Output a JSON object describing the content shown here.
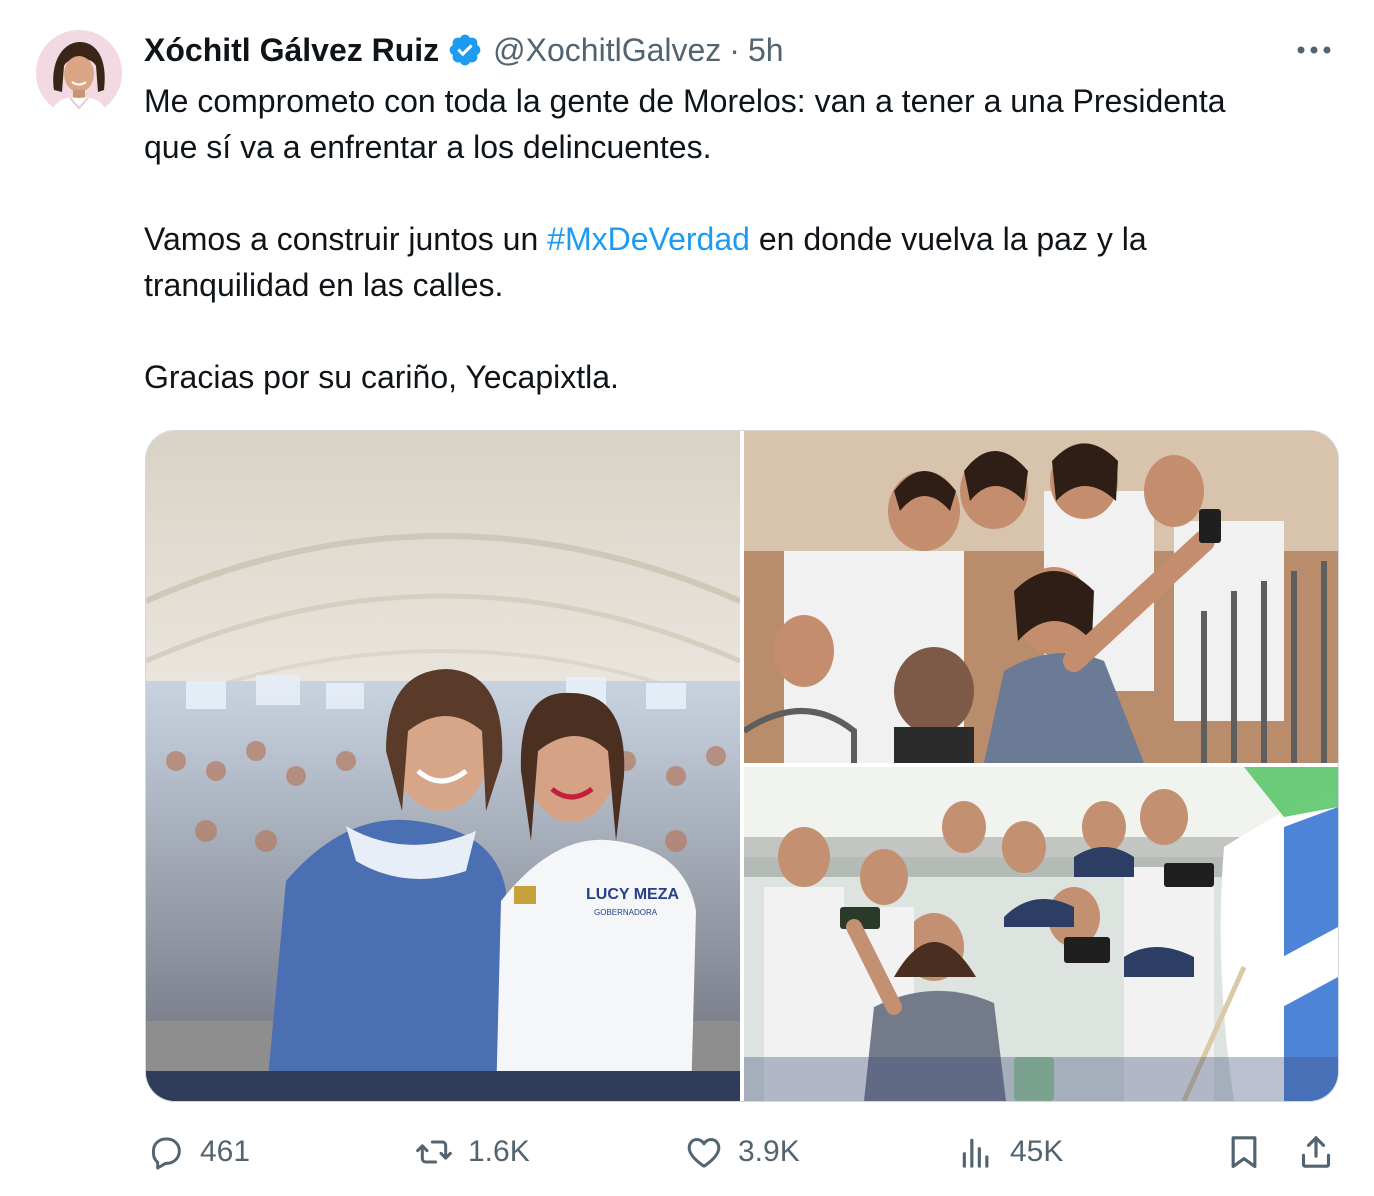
{
  "tweet": {
    "author": {
      "display_name": "Xóchitl Gálvez Ruiz",
      "handle": "@XochitlGalvez",
      "separator": "·",
      "time": "5h",
      "verified": true
    },
    "text": {
      "p1_line1": "Me comprometo con toda la gente de Morelos: van a tener a una Presidenta",
      "p1_line2": "que sí va a enfrentar a los delincuentes.",
      "p2_before": "Vamos a construir juntos un ",
      "p2_hashtag": "#MxDeVerdad",
      "p2_after": " en donde vuelva la paz y la",
      "p2_line2": "tranquilidad en las calles.",
      "p3": "Gracias por su cariño, Yecapixtla."
    },
    "media": {
      "count": 3,
      "photo_1_shirt_text": "LUCY MEZA",
      "photo_1_shirt_subtext": "GOBERNADORA"
    },
    "actions": {
      "replies": "461",
      "retweets": "1.6K",
      "likes": "3.9K",
      "views": "45K"
    }
  },
  "icons": {
    "more": "more-horizontal-icon",
    "verified": "verified-badge-icon",
    "reply": "reply-icon",
    "retweet": "retweet-icon",
    "like": "heart-icon",
    "views": "views-chart-icon",
    "bookmark": "bookmark-icon",
    "share": "share-icon"
  },
  "colors": {
    "text_primary": "#0f1419",
    "text_secondary": "#536471",
    "link": "#1d9bf0",
    "verified": "#1d9bf0",
    "border": "#cfd9de"
  }
}
